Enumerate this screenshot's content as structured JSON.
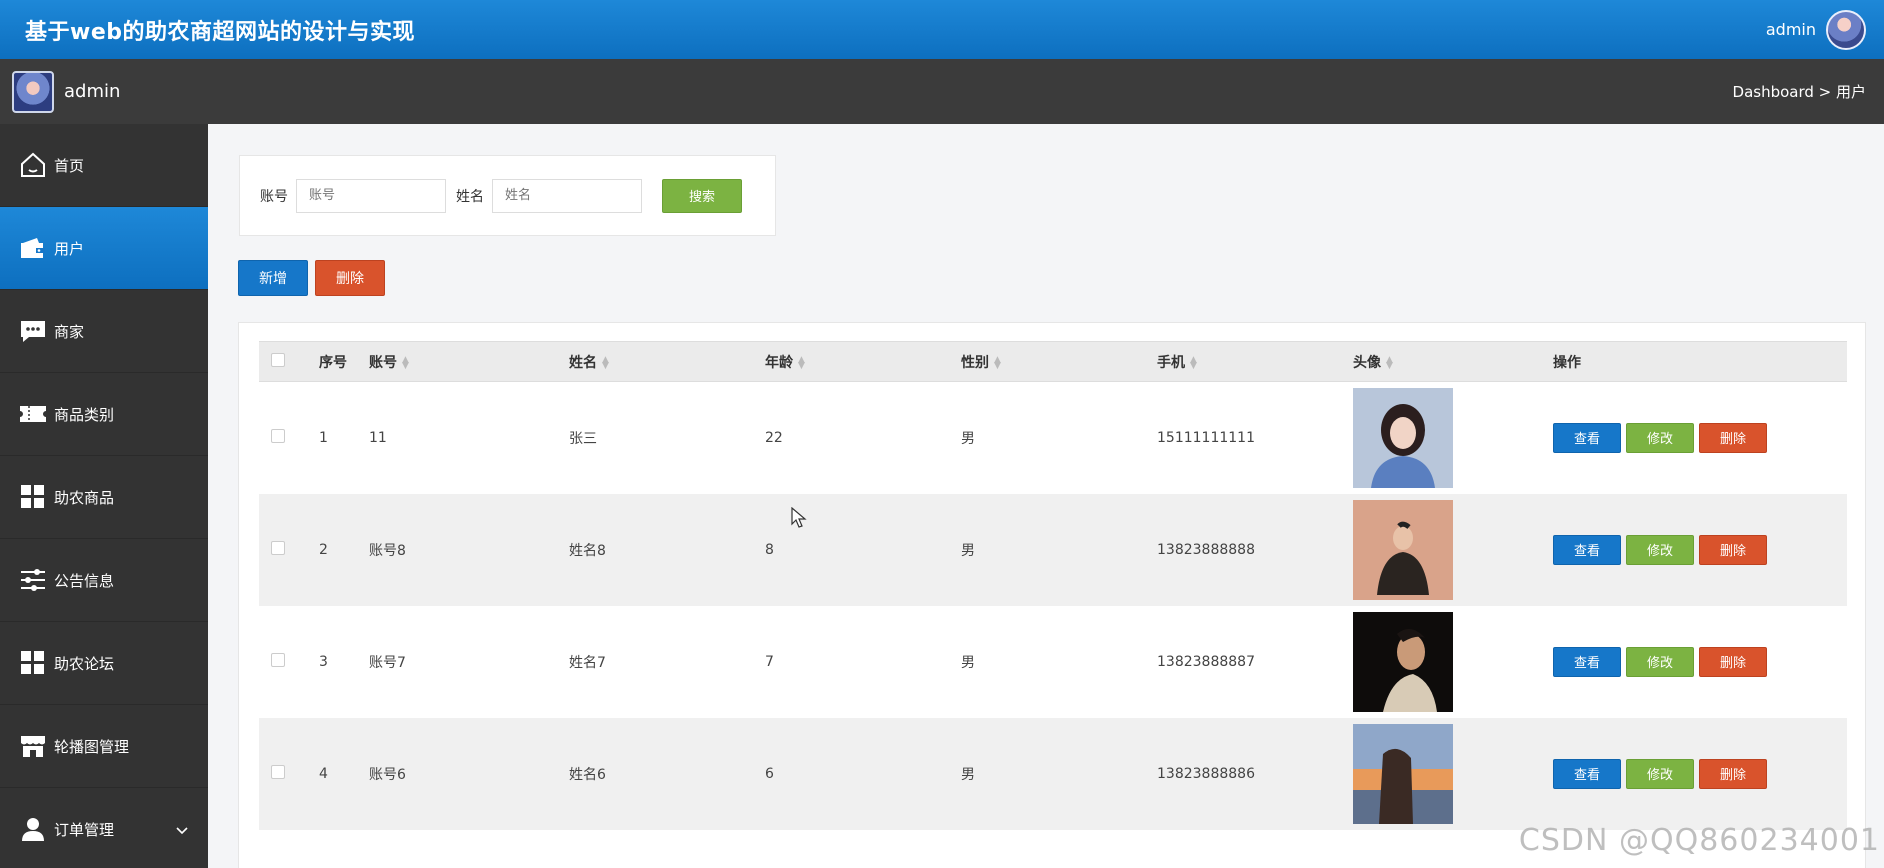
{
  "header": {
    "app_title": "基于web的助农商超网站的设计与实现",
    "user_name": "admin"
  },
  "subbar": {
    "profile_name": "admin",
    "breadcrumb": "Dashboard > 用户"
  },
  "sidebar": {
    "items": [
      {
        "label": "首页",
        "icon": "home-icon"
      },
      {
        "label": "用户",
        "icon": "wallet-icon",
        "active": true
      },
      {
        "label": "商家",
        "icon": "chat-icon"
      },
      {
        "label": "商品类别",
        "icon": "ticket-icon"
      },
      {
        "label": "助农商品",
        "icon": "grid-icon"
      },
      {
        "label": "公告信息",
        "icon": "sliders-icon"
      },
      {
        "label": "助农论坛",
        "icon": "grid-icon"
      },
      {
        "label": "轮播图管理",
        "icon": "store-icon"
      },
      {
        "label": "订单管理",
        "icon": "user-icon",
        "has_submenu": true
      }
    ]
  },
  "search": {
    "account_label": "账号",
    "account_placeholder": "账号",
    "name_label": "姓名",
    "name_placeholder": "姓名",
    "search_button": "搜索"
  },
  "actions": {
    "add_button": "新增",
    "delete_button": "删除"
  },
  "table": {
    "columns": [
      "序号",
      "账号",
      "姓名",
      "年龄",
      "性别",
      "手机",
      "头像",
      "操作"
    ],
    "rows": [
      {
        "index": "1",
        "account": "11",
        "name": "张三",
        "age": "22",
        "gender": "男",
        "phone": "15111111111"
      },
      {
        "index": "2",
        "account": "账号8",
        "name": "姓名8",
        "age": "8",
        "gender": "男",
        "phone": "13823888888"
      },
      {
        "index": "3",
        "account": "账号7",
        "name": "姓名7",
        "age": "7",
        "gender": "男",
        "phone": "13823888887"
      },
      {
        "index": "4",
        "account": "账号6",
        "name": "姓名6",
        "age": "6",
        "gender": "男",
        "phone": "13823888886"
      }
    ],
    "row_actions": {
      "view": "查看",
      "edit": "修改",
      "delete": "删除"
    }
  },
  "watermark": "CSDN @QQ860234001",
  "colors": {
    "header_blue": "#1677c9",
    "sidebar_dark": "#333333",
    "success_green": "#7cb342",
    "danger_red": "#d9532c"
  }
}
